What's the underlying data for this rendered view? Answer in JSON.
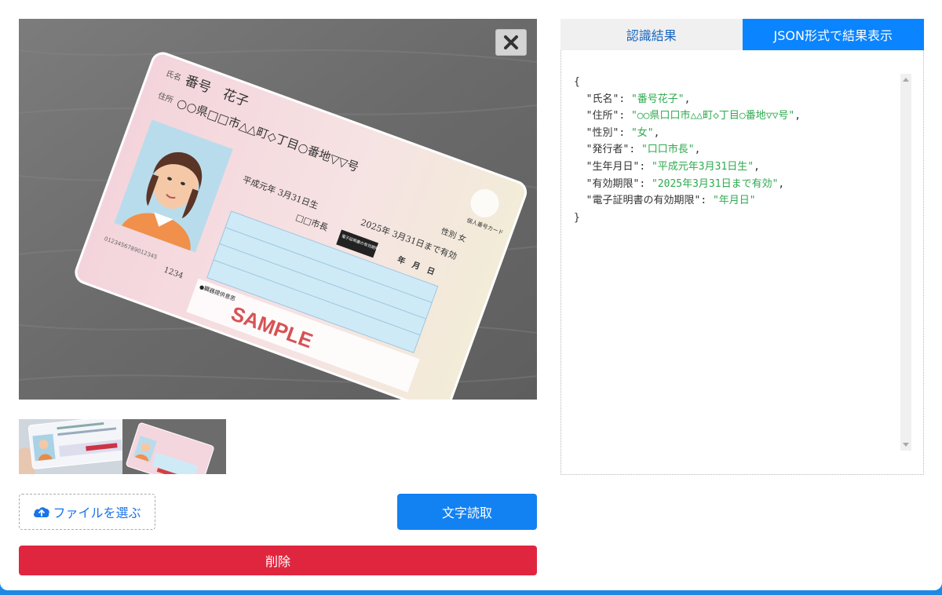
{
  "tabs": {
    "recognition_label": "認識結果",
    "json_label": "JSON形式で結果表示"
  },
  "buttons": {
    "choose_file_label": "ファイルを選ぶ",
    "read_text_label": "文字読取",
    "delete_label": "削除"
  },
  "json_result": {
    "open": "{",
    "close": "}",
    "entries": [
      {
        "key": "\"氏名\"",
        "value": "\"番号花子\""
      },
      {
        "key": "\"住所\"",
        "value": "\"○○県口口市△△町◇丁目○番地▽▽号\""
      },
      {
        "key": "\"性別\"",
        "value": "\"女\""
      },
      {
        "key": "\"発行者\"",
        "value": "\"口口市長\""
      },
      {
        "key": "\"生年月日\"",
        "value": "\"平成元年3月31日生\""
      },
      {
        "key": "\"有効期限\"",
        "value": "\"2025年3月31日まで有効\""
      },
      {
        "key": "\"電子証明書の有効期限\"",
        "value": "\"年月日\""
      }
    ]
  },
  "card": {
    "name_label": "氏名",
    "name": "番号　花子",
    "address_label": "住所",
    "address": "○○県□□市△△町◇丁目○番地▽▽号",
    "birth": "平成元年 3月31日生",
    "validity": "2025年 3月31日まで有効",
    "sex": "性別 女",
    "issuer": "□□市長",
    "ecert_label": "電子証明書の有効期限",
    "date_label": "年　月　日",
    "number": "0123456789012345",
    "code": "1234",
    "logo_text": "個人番号カード",
    "organ_note": "●臓器提供意思",
    "watermark": "SAMPLE"
  },
  "colors": {
    "accent": "#0a84ff",
    "read_button": "#1281f2",
    "delete_button": "#e0263f",
    "json_string": "#2eaa4f",
    "tab_text": "#1565c0",
    "bottom_strip": "#1e88e5"
  },
  "icons": {
    "close": "close-icon",
    "upload": "cloud-upload-icon"
  }
}
